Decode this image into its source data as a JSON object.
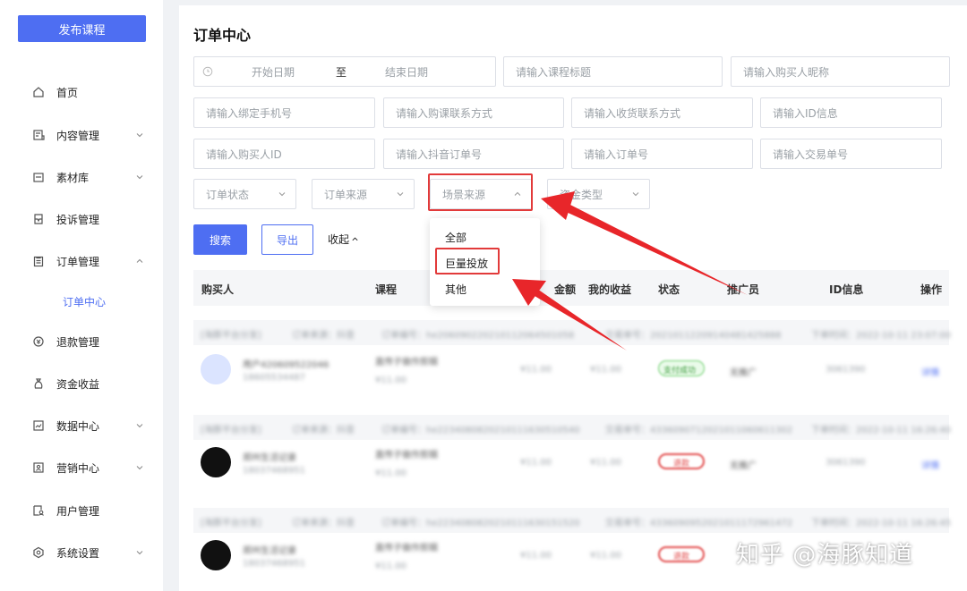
{
  "sidebar": {
    "publish_label": "发布课程",
    "items": [
      {
        "label": "首页",
        "icon": "home-icon"
      },
      {
        "label": "内容管理",
        "icon": "content-icon"
      },
      {
        "label": "素材库",
        "icon": "folder-icon"
      },
      {
        "label": "投诉管理",
        "icon": "inbox-icon"
      },
      {
        "label": "订单管理",
        "icon": "clipboard-icon"
      },
      {
        "label": "退款管理",
        "icon": "refund-icon"
      },
      {
        "label": "资金收益",
        "icon": "moneybag-icon"
      },
      {
        "label": "数据中心",
        "icon": "chart-icon"
      },
      {
        "label": "营销中心",
        "icon": "marketing-icon"
      },
      {
        "label": "用户管理",
        "icon": "user-icon"
      },
      {
        "label": "系统设置",
        "icon": "settings-icon"
      }
    ],
    "sub_active": "订单中心"
  },
  "page": {
    "title": "订单中心"
  },
  "filters": {
    "date_start": "开始日期",
    "date_sep": "至",
    "date_end": "结束日期",
    "course_title": "请输入课程标题",
    "buyer_nick": "请输入购买人昵称",
    "bound_phone": "请输入绑定手机号",
    "purchase_contact": "请输入购课联系方式",
    "receive_contact": "请输入收货联系方式",
    "id_info": "请输入ID信息",
    "buyer_id": "请输入购买人ID",
    "douyin_order": "请输入抖音订单号",
    "order_no": "请输入订单号",
    "trade_no": "请输入交易单号",
    "order_status": "订单状态",
    "order_source": "订单来源",
    "scene_source": "场景来源",
    "fund_type": "资金类型"
  },
  "actions": {
    "search": "搜索",
    "export": "导出",
    "collapse": "收起"
  },
  "dropdown": {
    "options": [
      "全部",
      "巨量投放",
      "其他"
    ],
    "highlighted": "巨量投放"
  },
  "table": {
    "headers": {
      "buyer": "购买人",
      "course": "课程",
      "amount": "金额",
      "income": "我的收益",
      "status": "状态",
      "promoter": "推广员",
      "id_info": "ID信息",
      "ops": "操作"
    },
    "rows": [
      {
        "meta_channel": "[海豚平台分发]",
        "meta_source": "订单来源：抖音",
        "meta_order": "订单编号：he206090220210112064501058",
        "meta_trade": "交易单号：20210112209140481425888",
        "meta_time": "下单时间：2022-10-11 23:07:00",
        "buyer_name": "用户420609522046",
        "buyer_phone": "18605534487",
        "course": "直传子做作剪辑",
        "course_price": "¥11.00",
        "amount": "¥11.00",
        "income": "¥11.00",
        "status": "支付成功",
        "promoter": "无推广",
        "id_info": "3061390",
        "op": "详情"
      },
      {
        "meta_channel": "[海豚平台分发]",
        "meta_source": "订单来源：抖音",
        "meta_order": "订单编号：he2234080820210111630510540",
        "meta_trade": "交易单号：4336090712021011060611302",
        "meta_time": "下单时间：2022-10-11 16:26:40",
        "buyer_name": "郑州生活记录",
        "buyer_phone": "18037468951",
        "course": "直传子做作剪辑",
        "course_price": "¥11.00",
        "amount": "¥11.00",
        "income": "¥11.00",
        "status": "退款",
        "promoter": "无推广",
        "id_info": "3061390",
        "op": "详情"
      },
      {
        "meta_channel": "[海豚平台分发]",
        "meta_source": "订单来源：抖音",
        "meta_order": "订单编号：he2234080820210111630151520",
        "meta_trade": "交易单号：4336090952021011172961472",
        "meta_time": "下单时间：2022-10-11 16:26:45",
        "buyer_name": "郑州生活记录",
        "buyer_phone": "18037468951",
        "course": "直传子做作剪辑",
        "course_price": "¥11.00",
        "amount": "¥11.00",
        "income": "¥11.00",
        "status": "退款",
        "promoter": "",
        "id_info": "",
        "op": ""
      }
    ]
  },
  "watermark": "知乎 @海豚知道",
  "colors": {
    "accent": "#4e6ef2",
    "highlight": "#e23a3a"
  }
}
